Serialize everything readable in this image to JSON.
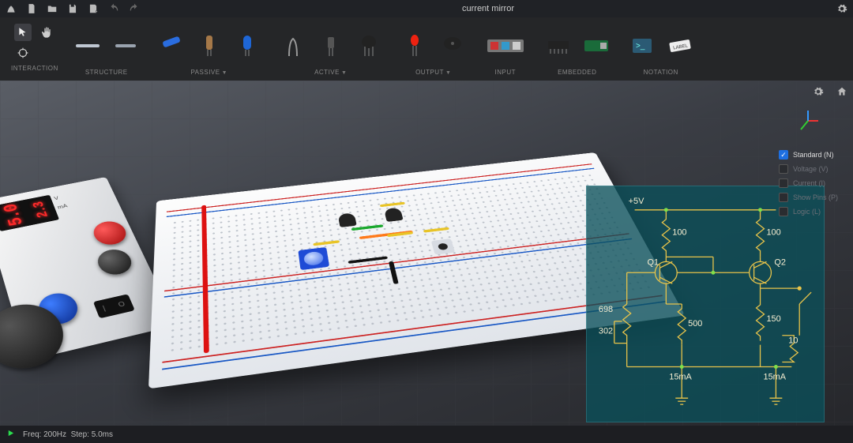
{
  "title": "current mirror",
  "menubar_icons": [
    "app-icon",
    "new-file-icon",
    "open-folder-icon",
    "save-icon",
    "save-as-icon",
    "undo-icon",
    "redo-icon"
  ],
  "settings_icon": "gear-icon",
  "toolbar": {
    "interaction": {
      "label": "INTERACTION"
    },
    "structure": {
      "label": "STRUCTURE"
    },
    "passive": {
      "label": "PASSIVE",
      "has_more": true
    },
    "active": {
      "label": "ACTIVE",
      "has_more": true
    },
    "output": {
      "label": "OUTPUT",
      "has_more": true
    },
    "input": {
      "label": "INPUT"
    },
    "embedded": {
      "label": "EMBEDDED"
    },
    "notation": {
      "label": "NOTATION"
    }
  },
  "psu": {
    "readout_left": "5.0",
    "readout_right": "2.3",
    "unit_left": "V",
    "unit_right": "mA",
    "switch_on": "|",
    "switch_off": "O"
  },
  "hud": {
    "view_settings_icon": "gear-icon",
    "home_icon": "home-icon"
  },
  "layers": [
    {
      "label": "Standard (N)",
      "checked": true
    },
    {
      "label": "Voltage (V)",
      "checked": false
    },
    {
      "label": "Current (I)",
      "checked": false
    },
    {
      "label": "Show Pins (P)",
      "checked": false
    },
    {
      "label": "Logic (L)",
      "checked": false
    }
  ],
  "schematic": {
    "vcc": "+5V",
    "r_top_left": "100",
    "r_top_right": "100",
    "q1": "Q1",
    "q2": "Q2",
    "r_pot_top": "698",
    "r_pot_bot": "302",
    "r_mid": "500",
    "r_load1": "150",
    "r_load2": "10",
    "i_left": "15mA",
    "i_right": "15mA"
  },
  "status": {
    "freq_label": "Freq:",
    "freq_value": "200Hz",
    "step_label": "Step:",
    "step_value": "5.0ms"
  }
}
